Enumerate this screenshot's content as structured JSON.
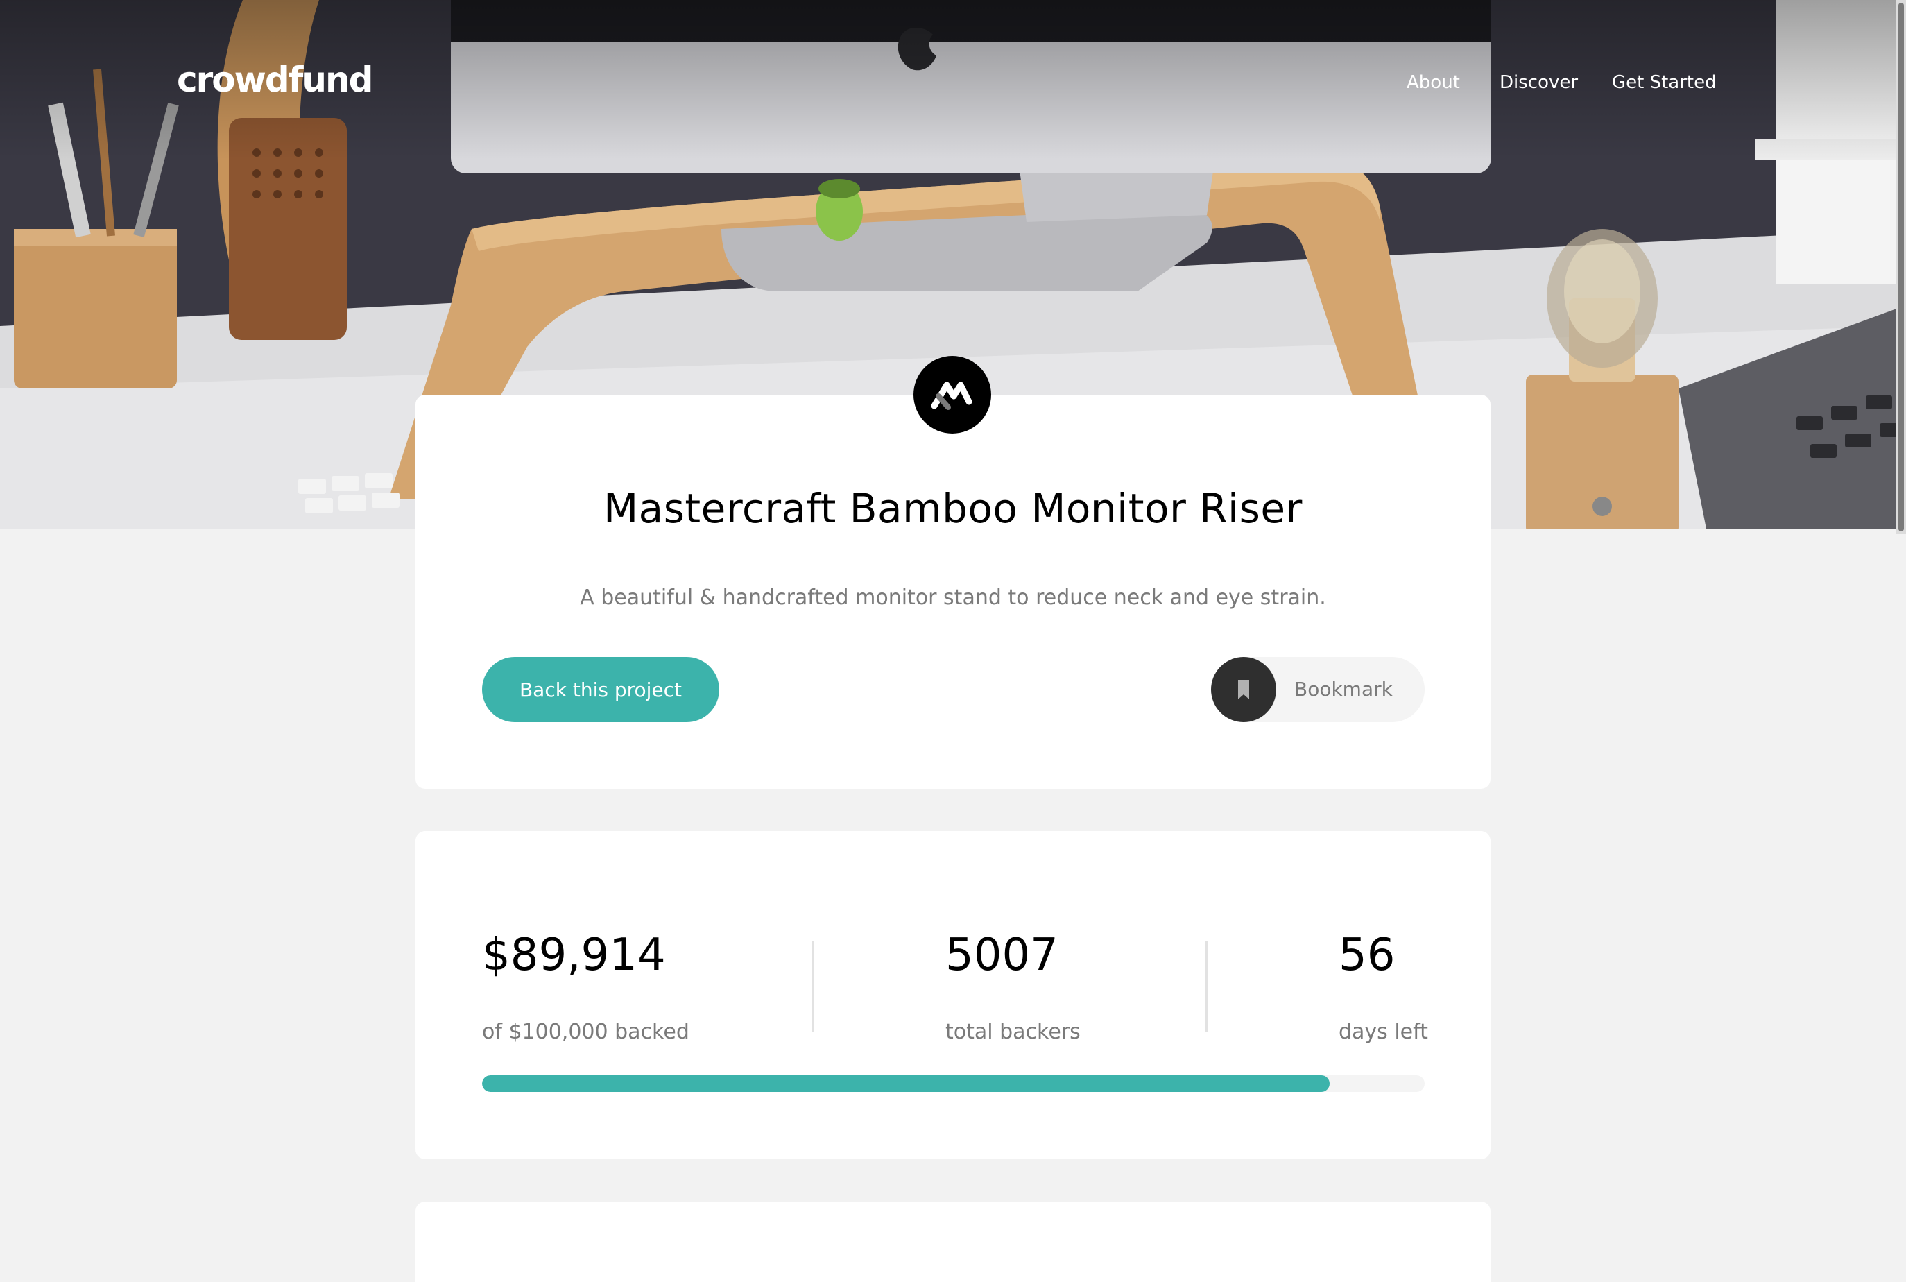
{
  "header": {
    "brand": "crowdfund",
    "nav": [
      {
        "label": "About"
      },
      {
        "label": "Discover"
      },
      {
        "label": "Get Started"
      }
    ]
  },
  "project": {
    "title": "Mastercraft Bamboo Monitor Riser",
    "description": "A beautiful & handcrafted monitor stand to reduce neck and eye strain.",
    "back_label": "Back this project",
    "bookmark_label": "Bookmark"
  },
  "stats": {
    "backed_amount": "$89,914",
    "backed_caption": "of $100,000 backed",
    "backers": "5007",
    "backers_caption": "total backers",
    "days": "56",
    "days_caption": "days left",
    "progress_fraction": 0.899
  },
  "colors": {
    "accent": "#3cb3ab",
    "background": "#f2f2f2",
    "card": "#ffffff",
    "text_dark": "#000000",
    "text_muted": "#7a7a7a"
  },
  "icons": {
    "logo": "mastercraft-logo-icon",
    "bookmark": "bookmark-icon"
  }
}
